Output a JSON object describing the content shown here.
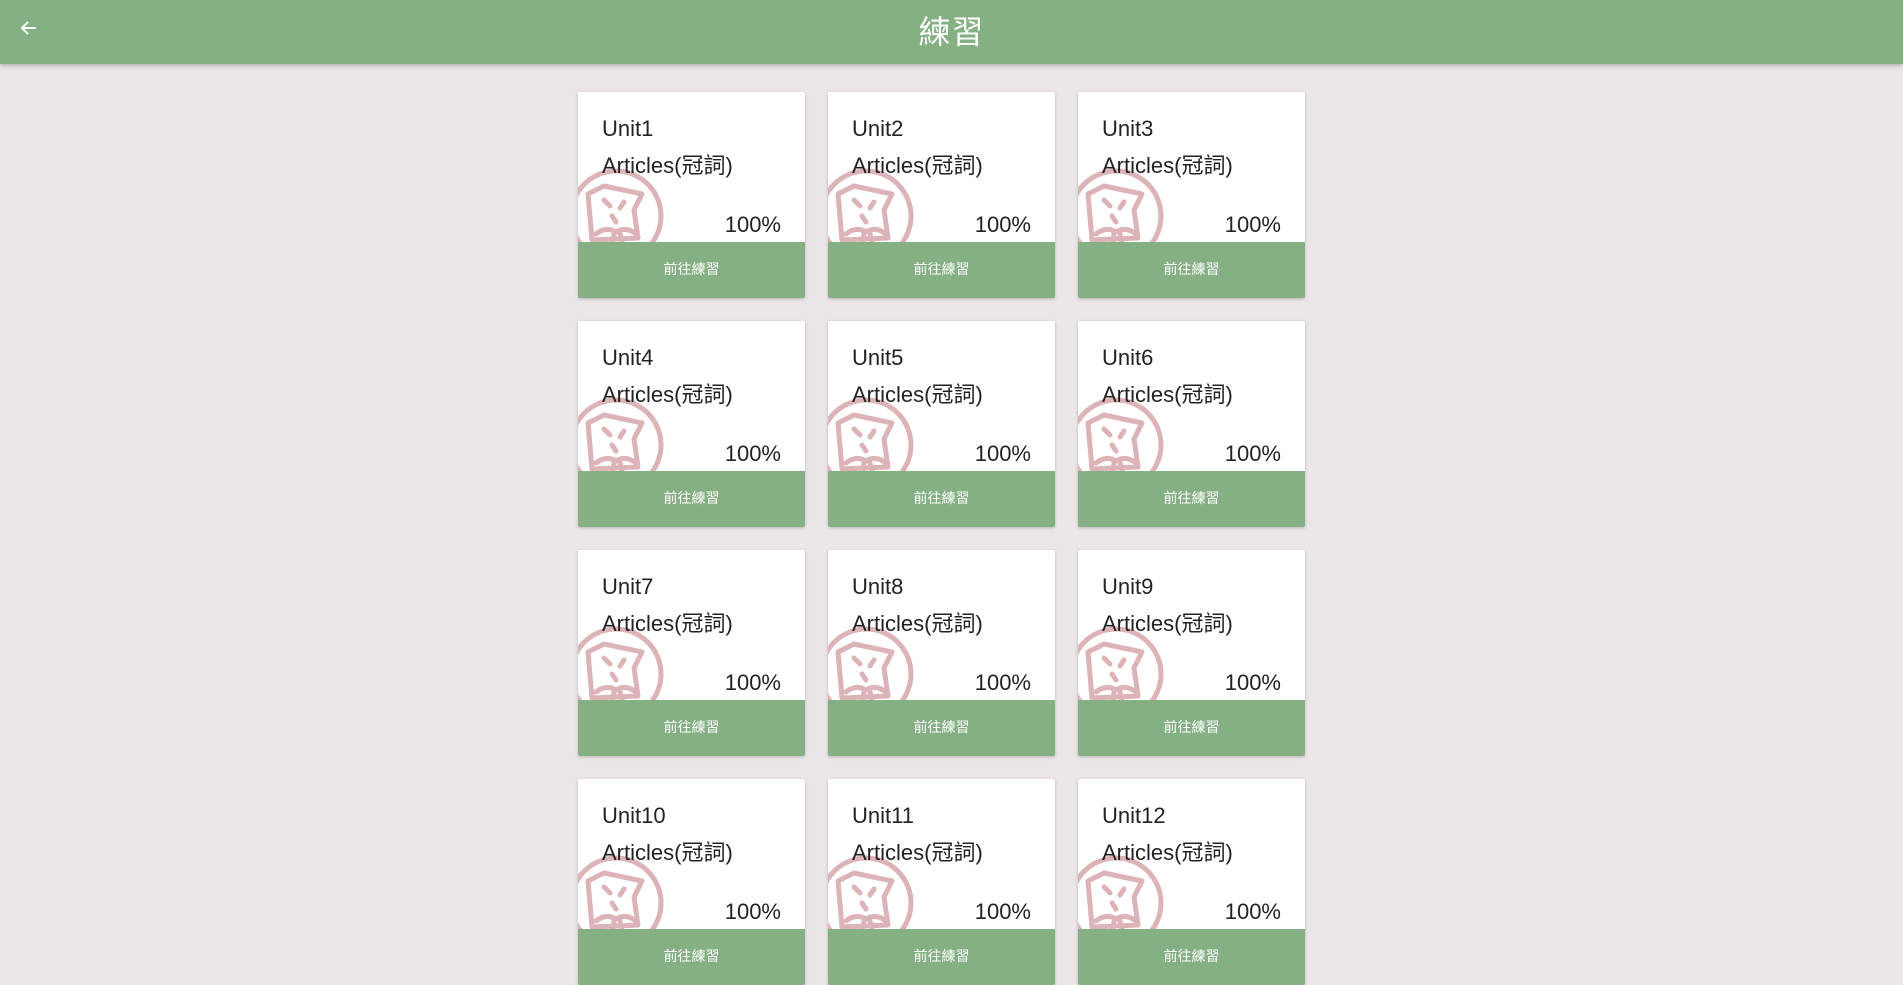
{
  "header": {
    "title": "練習",
    "back_icon": "arrow-left-icon"
  },
  "colors": {
    "header_bg": "#85b084",
    "page_bg": "#ebe6e8",
    "stamp": "#dcb3b6"
  },
  "cards": [
    {
      "unit": "Unit1",
      "topic": "Articles(冠詞)",
      "progress": "100%",
      "action_label": "前往練習"
    },
    {
      "unit": "Unit2",
      "topic": "Articles(冠詞)",
      "progress": "100%",
      "action_label": "前往練習"
    },
    {
      "unit": "Unit3",
      "topic": "Articles(冠詞)",
      "progress": "100%",
      "action_label": "前往練習"
    },
    {
      "unit": "Unit4",
      "topic": "Articles(冠詞)",
      "progress": "100%",
      "action_label": "前往練習"
    },
    {
      "unit": "Unit5",
      "topic": "Articles(冠詞)",
      "progress": "100%",
      "action_label": "前往練習"
    },
    {
      "unit": "Unit6",
      "topic": "Articles(冠詞)",
      "progress": "100%",
      "action_label": "前往練習"
    },
    {
      "unit": "Unit7",
      "topic": "Articles(冠詞)",
      "progress": "100%",
      "action_label": "前往練習"
    },
    {
      "unit": "Unit8",
      "topic": "Articles(冠詞)",
      "progress": "100%",
      "action_label": "前往練習"
    },
    {
      "unit": "Unit9",
      "topic": "Articles(冠詞)",
      "progress": "100%",
      "action_label": "前往練習"
    },
    {
      "unit": "Unit10",
      "topic": "Articles(冠詞)",
      "progress": "100%",
      "action_label": "前往練習"
    },
    {
      "unit": "Unit11",
      "topic": "Articles(冠詞)",
      "progress": "100%",
      "action_label": "前往練習"
    },
    {
      "unit": "Unit12",
      "topic": "Articles(冠詞)",
      "progress": "100%",
      "action_label": "前往練習"
    }
  ],
  "card_watermark_icon": "face-stamp-icon"
}
